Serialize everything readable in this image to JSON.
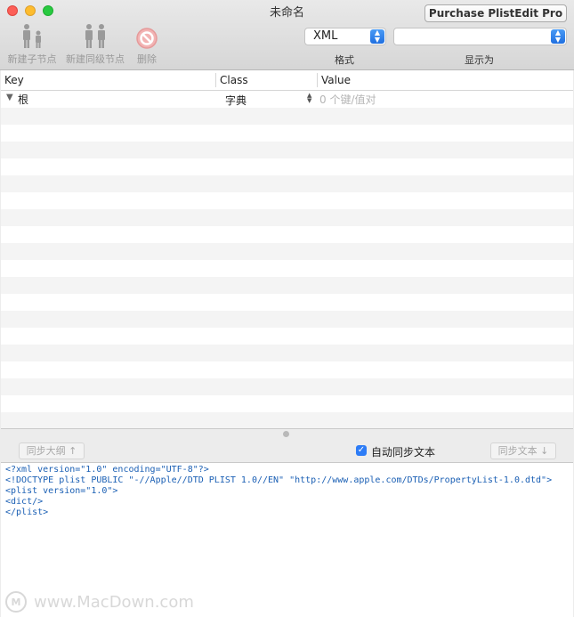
{
  "window": {
    "title": "未命名",
    "purchase_button": "Purchase PlistEdit Pro"
  },
  "toolbar": {
    "new_child_label": "新建子节点",
    "new_sibling_label": "新建同级节点",
    "delete_label": "删除",
    "format_value": "XML",
    "format_label": "格式",
    "display_value": "",
    "display_label": "显示为"
  },
  "table": {
    "columns": [
      "Key",
      "Class",
      "Value"
    ],
    "root": {
      "key": "根",
      "class": "字典",
      "value": "0 个键/值对"
    }
  },
  "bottom_bar": {
    "sync_outline_label": "同步大纲 ↑",
    "auto_sync_label": "自动同步文本",
    "auto_sync_checked": true,
    "sync_text_label": "同步文本 ↓"
  },
  "code": {
    "lines": [
      "<?xml version=\"1.0\" encoding=\"UTF-8\"?>",
      "<!DOCTYPE plist PUBLIC \"-//Apple//DTD PLIST 1.0//EN\" \"http://www.apple.com/DTDs/PropertyList-1.0.dtd\">",
      "<plist version=\"1.0\">",
      "<dict/>",
      "</plist>"
    ]
  },
  "watermark": {
    "text": "www.MacDown.com",
    "logo_letter": "M"
  },
  "colors": {
    "accent": "#2d7cf6",
    "code_text": "#1a5fb4"
  }
}
